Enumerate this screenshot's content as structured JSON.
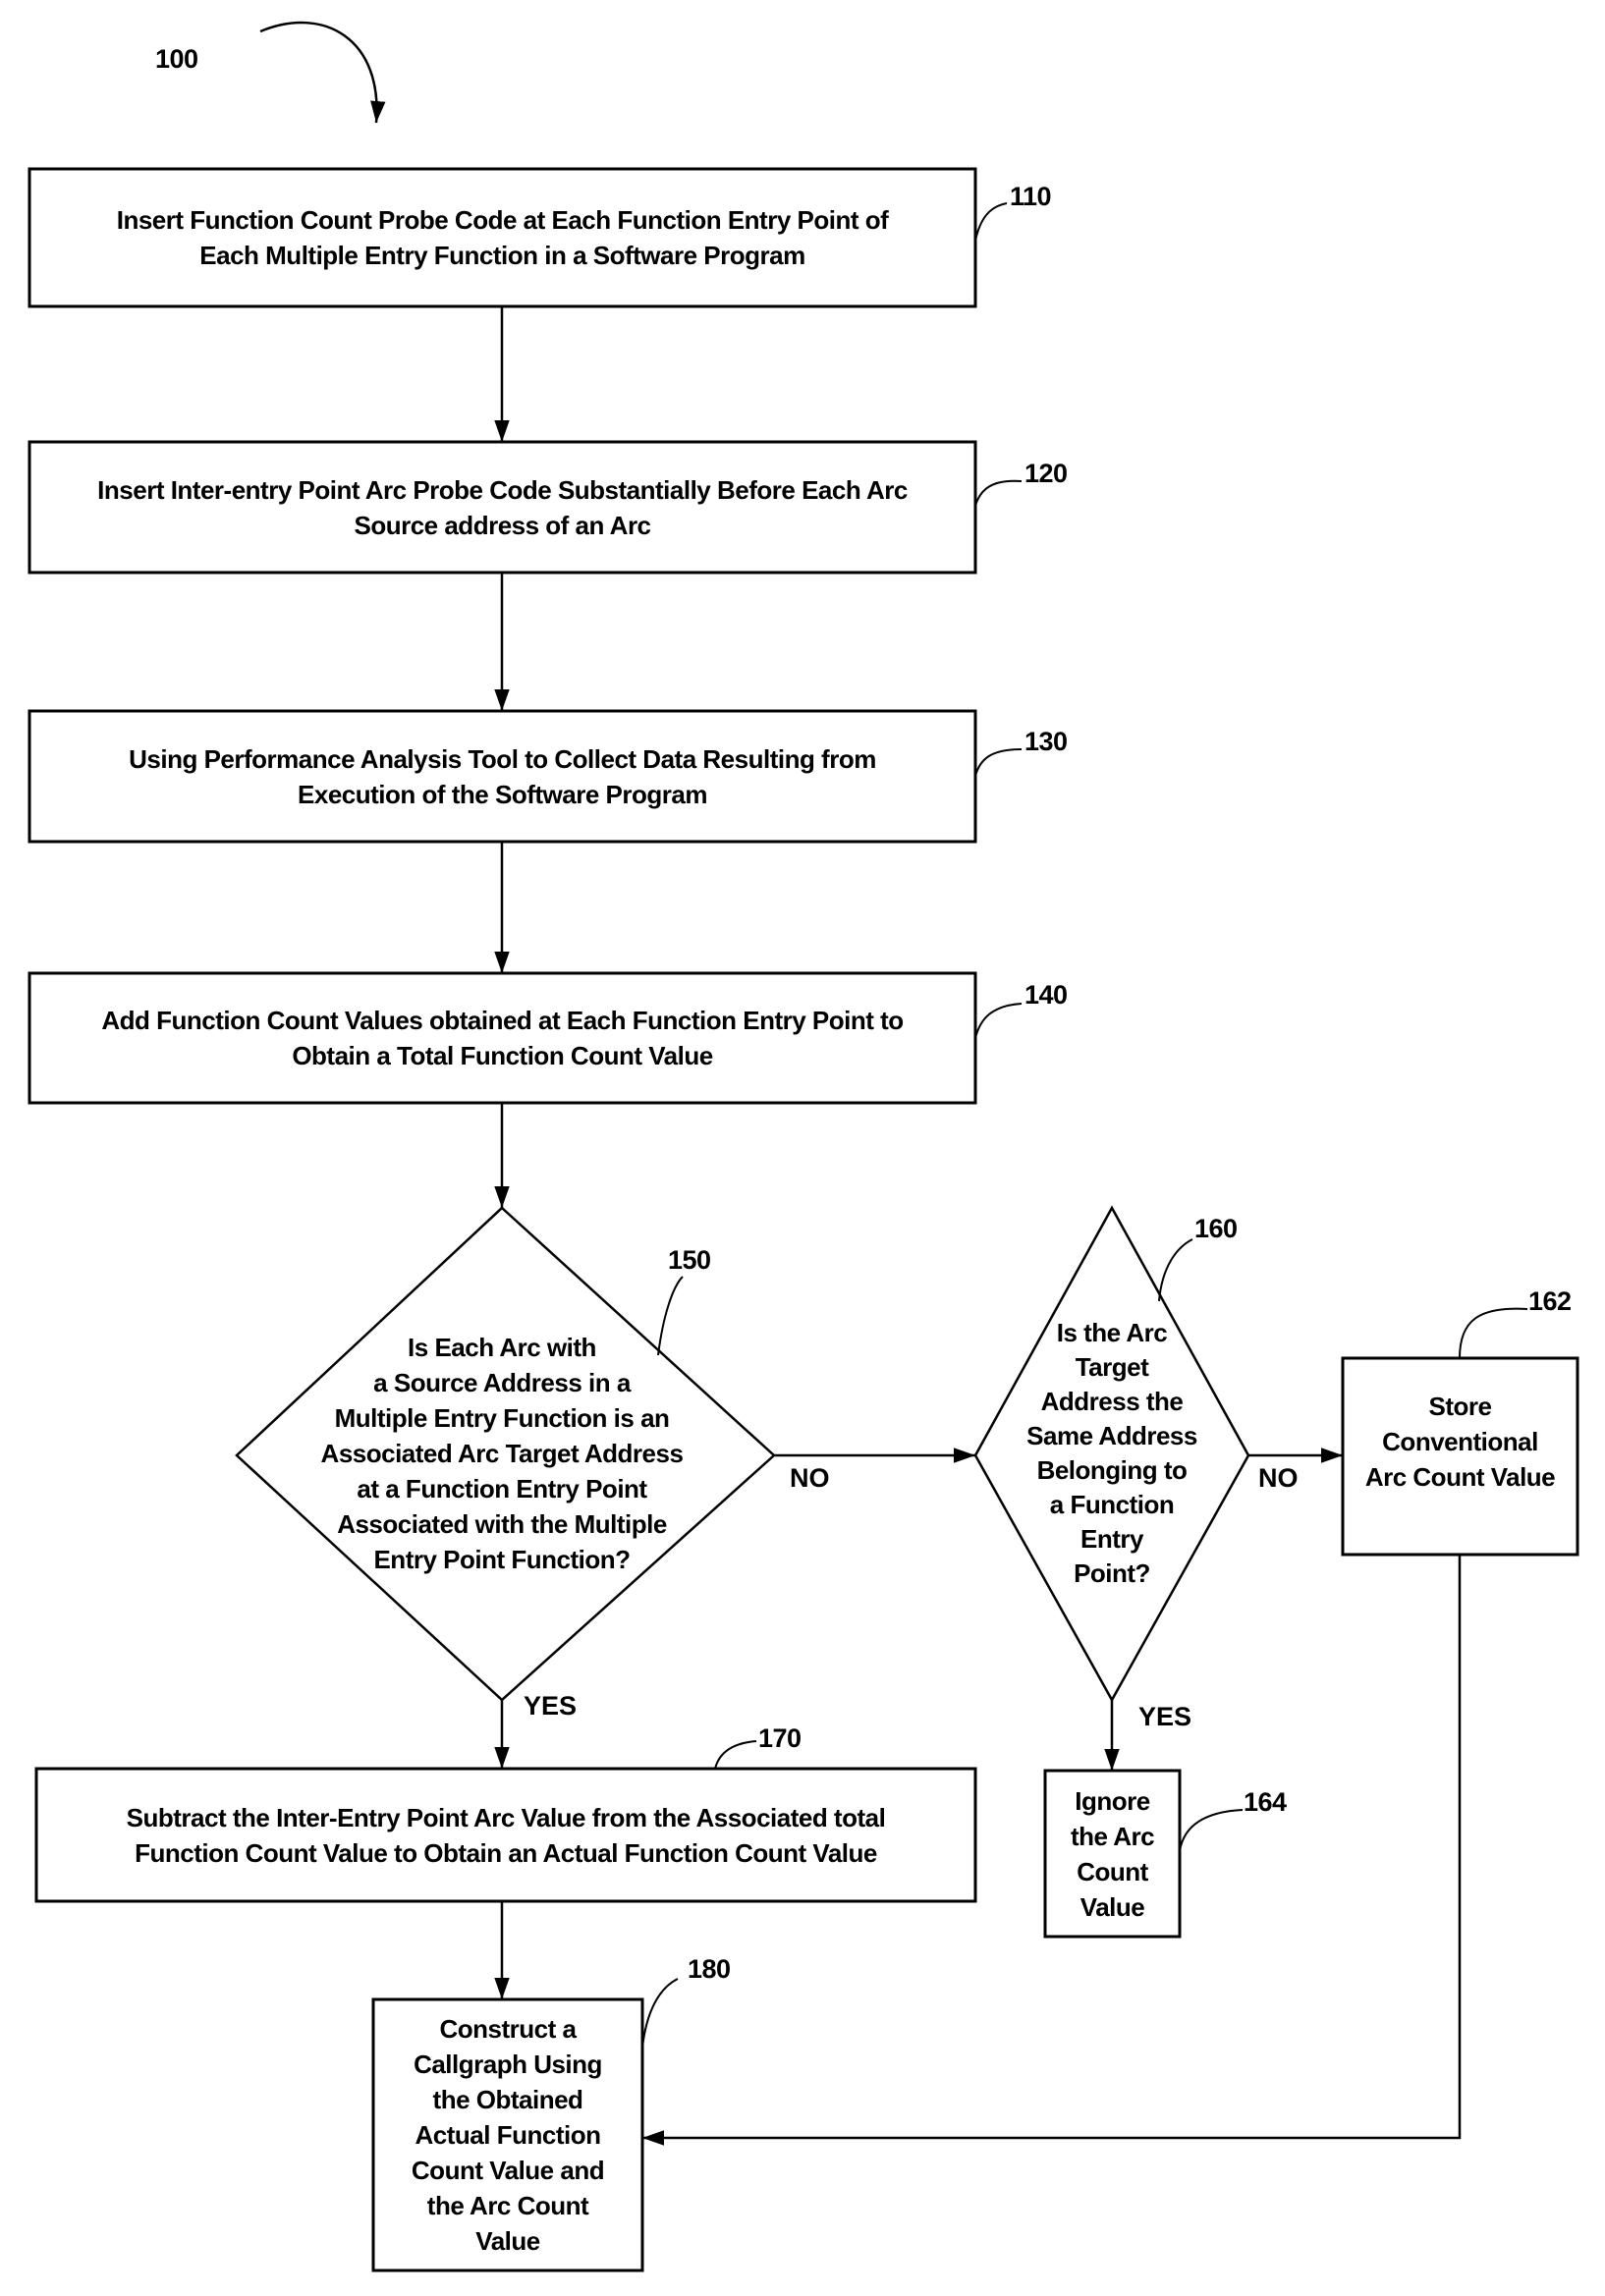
{
  "figure": {
    "ref_label": "100",
    "steps": {
      "s110": {
        "ref": "110",
        "text": "Insert Function Count Probe Code at Each Function Entry Point of\nEach Multiple Entry Function in a Software Program"
      },
      "s120": {
        "ref": "120",
        "text": "Insert Inter-entry Point Arc Probe Code Substantially Before Each Arc\nSource address of an Arc"
      },
      "s130": {
        "ref": "130",
        "text": "Using Performance Analysis Tool to Collect Data Resulting from\nExecution of the Software Program"
      },
      "s140": {
        "ref": "140",
        "text": "Add Function Count Values obtained at Each Function Entry Point to\nObtain a Total Function Count Value"
      },
      "s150": {
        "ref": "150",
        "text": "Is Each Arc with\na Source Address in a\nMultiple Entry Function is an\nAssociated Arc Target Address\nat a Function Entry Point\nAssociated with the Multiple\nEntry Point Function?"
      },
      "s160": {
        "ref": "160",
        "text": "Is the Arc\nTarget\nAddress the\nSame Address\nBelonging to\na Function\nEntry\nPoint?"
      },
      "s162": {
        "ref": "162",
        "text": "Store\nConventional\nArc Count Value"
      },
      "s164": {
        "ref": "164",
        "text": "Ignore\nthe Arc\nCount\nValue"
      },
      "s170": {
        "ref": "170",
        "text": "Subtract the Inter-Entry Point Arc Value from the Associated total\nFunction Count Value to Obtain an Actual Function Count Value"
      },
      "s180": {
        "ref": "180",
        "text": "Construct a\nCallgraph Using\nthe Obtained\nActual Function\nCount Value and\nthe Arc Count\nValue"
      }
    },
    "branches": {
      "b150_no": "NO",
      "b150_yes": "YES",
      "b160_no": "NO",
      "b160_yes": "YES"
    }
  }
}
